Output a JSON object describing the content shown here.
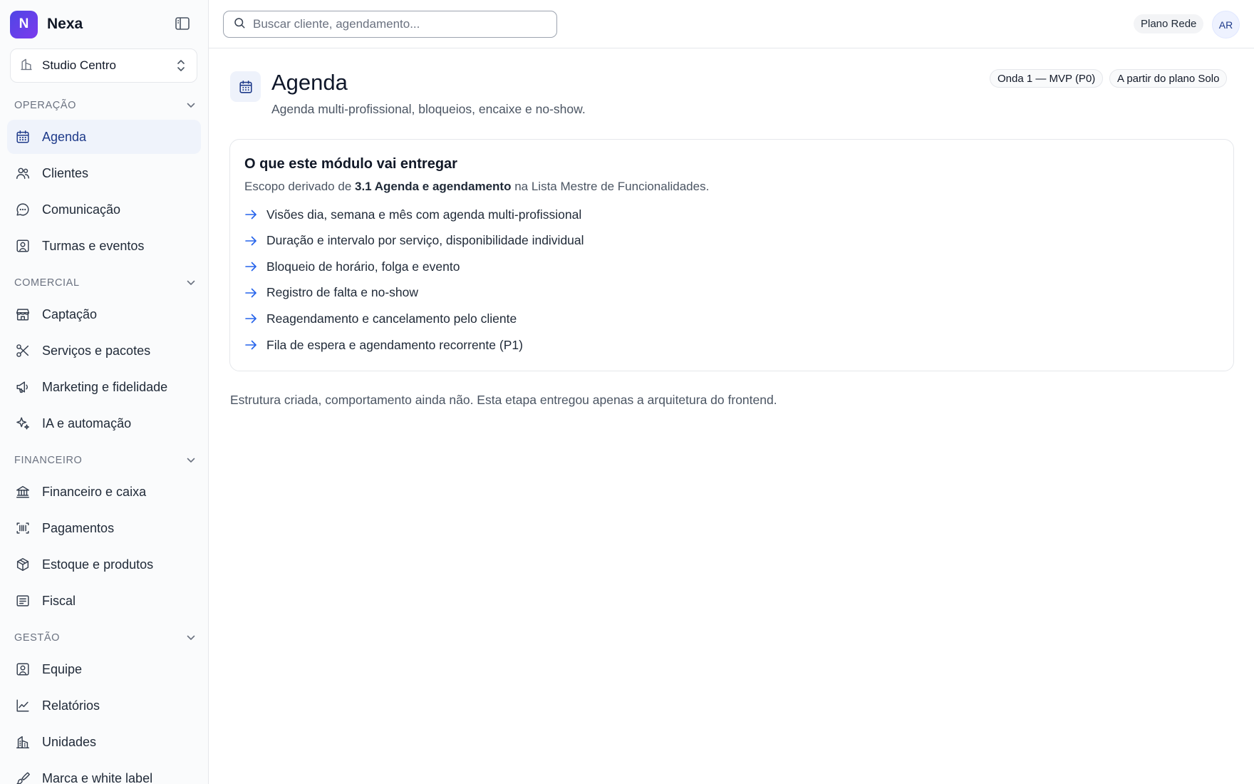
{
  "brand": {
    "initial": "N",
    "name": "Nexa"
  },
  "unit_selector": {
    "value": "Studio Centro"
  },
  "sidebar": {
    "sections": [
      {
        "label": "OPERAÇÃO",
        "items": [
          {
            "label": "Agenda",
            "icon": "calendar-icon",
            "active": true
          },
          {
            "label": "Clientes",
            "icon": "users-icon"
          },
          {
            "label": "Comunicação",
            "icon": "message-circle-icon"
          },
          {
            "label": "Turmas e eventos",
            "icon": "user-square-icon"
          }
        ]
      },
      {
        "label": "COMERCIAL",
        "items": [
          {
            "label": "Captação",
            "icon": "store-icon"
          },
          {
            "label": "Serviços e pacotes",
            "icon": "scissors-icon"
          },
          {
            "label": "Marketing e fidelidade",
            "icon": "megaphone-icon"
          },
          {
            "label": "IA e automação",
            "icon": "sparkles-icon"
          }
        ]
      },
      {
        "label": "FINANCEIRO",
        "items": [
          {
            "label": "Financeiro e caixa",
            "icon": "bank-icon"
          },
          {
            "label": "Pagamentos",
            "icon": "barcode-icon"
          },
          {
            "label": "Estoque e produtos",
            "icon": "package-icon"
          },
          {
            "label": "Fiscal",
            "icon": "receipt-icon"
          }
        ]
      },
      {
        "label": "GESTÃO",
        "items": [
          {
            "label": "Equipe",
            "icon": "user-square-icon"
          },
          {
            "label": "Relatórios",
            "icon": "line-chart-icon"
          },
          {
            "label": "Unidades",
            "icon": "building-icon"
          },
          {
            "label": "Marca e white label",
            "icon": "brush-icon"
          }
        ]
      }
    ]
  },
  "topbar": {
    "search_placeholder": "Buscar cliente, agendamento...",
    "plan": "Plano Rede",
    "avatar_initials": "AR"
  },
  "page": {
    "title": "Agenda",
    "subtitle": "Agenda multi-profissional, bloqueios, encaixe e no-show.",
    "badges": [
      "Onda 1 — MVP (P0)",
      "A partir do plano Solo"
    ]
  },
  "card": {
    "title": "O que este módulo vai entregar",
    "desc_prefix": "Escopo derivado de ",
    "desc_bold": "3.1 Agenda e agendamento",
    "desc_suffix": " na Lista Mestre de Funcionalidades.",
    "features": [
      "Visões dia, semana e mês com agenda multi-profissional",
      "Duração e intervalo por serviço, disponibilidade individual",
      "Bloqueio de horário, folga e evento",
      "Registro de falta e no-show",
      "Reagendamento e cancelamento pelo cliente",
      "Fila de espera e agendamento recorrente (P1)"
    ]
  },
  "footnote": "Estrutura criada, comportamento ainda não. Esta etapa entregou apenas a arquitetura do frontend.",
  "colors": {
    "accent": "#1e3a8a",
    "brand_gradient_start": "#4f46e5",
    "brand_gradient_end": "#7c3aed",
    "arrow": "#2563eb"
  }
}
